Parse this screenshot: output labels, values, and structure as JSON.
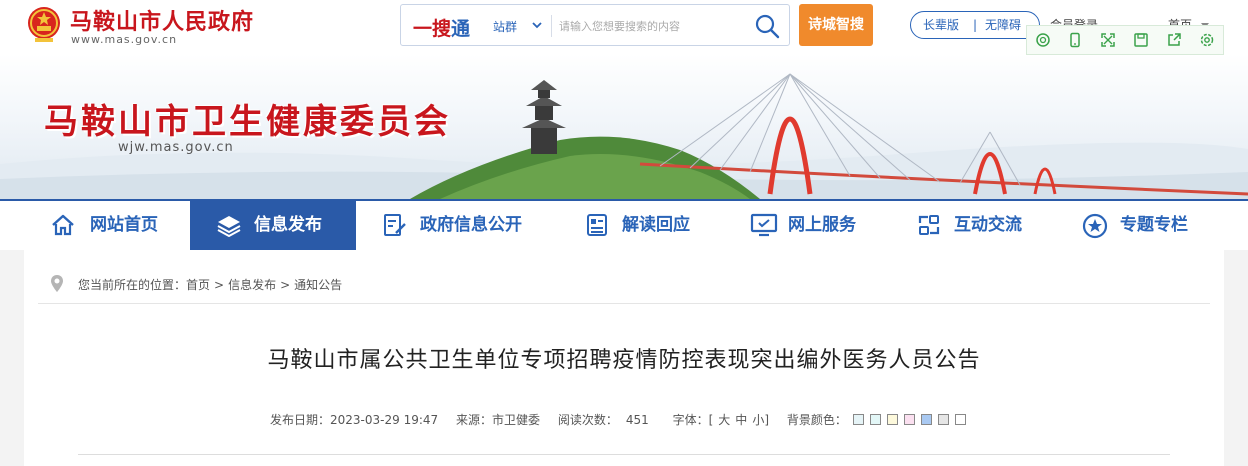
{
  "header": {
    "site_name": "马鞍山市人民政府",
    "site_domain": "www.mas.gov.cn",
    "search": {
      "logo_red": "一搜",
      "logo_blue": "通",
      "scope": "站群",
      "placeholder": "请输入您想要搜索的内容"
    },
    "brand_button": "诗城智搜",
    "elder_mode": "长辈版",
    "separator": "|",
    "accessibility": "无障碍",
    "login": "会员登录",
    "home": "首页"
  },
  "toolbar": {
    "icons": [
      "search-icon",
      "mobile-icon",
      "fullscreen-icon",
      "save-icon",
      "share-icon",
      "settings-icon"
    ],
    "color": "#3aa24a"
  },
  "banner": {
    "title": "马鞍山市卫生健康委员会",
    "domain": "wjw.mas.gov.cn"
  },
  "nav": {
    "items": [
      {
        "label": "网站首页",
        "icon": "home-icon"
      },
      {
        "label": "信息发布",
        "icon": "layers-icon"
      },
      {
        "label": "政府信息公开",
        "icon": "document-edit-icon"
      },
      {
        "label": "解读回应",
        "icon": "document-list-icon"
      },
      {
        "label": "网上服务",
        "icon": "monitor-icon"
      },
      {
        "label": "互动交流",
        "icon": "exchange-icon"
      },
      {
        "label": "专题专栏",
        "icon": "star-icon"
      }
    ],
    "active_index": 1
  },
  "breadcrumb": {
    "prefix": "您当前所在的位置：",
    "items": [
      "首页",
      "信息发布",
      "通知公告"
    ],
    "separator": ">"
  },
  "article": {
    "title": "马鞍山市属公共卫生单位专项招聘疫情防控表现突出编外医务人员公告",
    "meta": {
      "date_label": "发布日期：",
      "date": "2023-03-29 19:47",
      "source_label": "来源：",
      "source": "市卫健委",
      "views_label": "阅读次数：",
      "views": "451",
      "font_label": "字体：[",
      "font_large": "大",
      "font_medium": "中",
      "font_small": "小",
      "font_close": "]",
      "bg_label": "背景颜色："
    },
    "bg_colors": [
      "#e6f4f7",
      "#e3f7f7",
      "#fdf9dc",
      "#fbe0f0",
      "#a9c9f2",
      "#e6e6e6",
      "#ffffff"
    ]
  },
  "colors": {
    "brand_red": "#c8161d",
    "nav_blue": "#2a5aa8",
    "accent_orange": "#f08a2c"
  }
}
